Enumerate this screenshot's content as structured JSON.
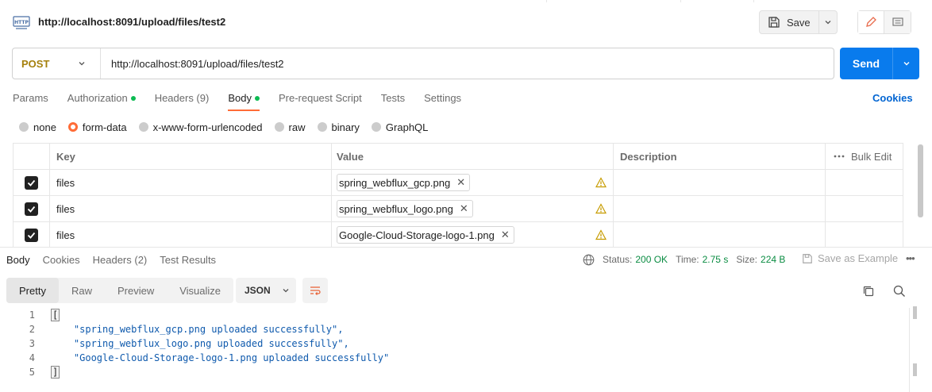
{
  "header": {
    "title": "http://localhost:8091/upload/files/test2",
    "save_label": "Save"
  },
  "request": {
    "method": "POST",
    "url": "http://localhost:8091/upload/files/test2",
    "send_label": "Send"
  },
  "request_tabs": [
    {
      "label": "Params",
      "dot": false
    },
    {
      "label": "Authorization",
      "dot": true
    },
    {
      "label": "Headers (9)",
      "dot": false
    },
    {
      "label": "Body",
      "dot": true,
      "active": true
    },
    {
      "label": "Pre-request Script",
      "dot": false
    },
    {
      "label": "Tests",
      "dot": false
    },
    {
      "label": "Settings",
      "dot": false
    }
  ],
  "cookies_label": "Cookies",
  "body_types": [
    {
      "label": "none",
      "selected": false
    },
    {
      "label": "form-data",
      "selected": true
    },
    {
      "label": "x-www-form-urlencoded",
      "selected": false
    },
    {
      "label": "raw",
      "selected": false
    },
    {
      "label": "binary",
      "selected": false
    },
    {
      "label": "GraphQL",
      "selected": false
    }
  ],
  "form_table": {
    "headers": {
      "key": "Key",
      "value": "Value",
      "description": "Description",
      "bulk_edit": "Bulk Edit"
    },
    "rows": [
      {
        "checked": true,
        "key": "files",
        "file": "spring_webflux_gcp.png"
      },
      {
        "checked": true,
        "key": "files",
        "file": "spring_webflux_logo.png"
      },
      {
        "checked": true,
        "key": "files",
        "file": "Google-Cloud-Storage-logo-1.png"
      }
    ]
  },
  "response_tabs": [
    {
      "label": "Body",
      "active": true
    },
    {
      "label": "Cookies",
      "active": false
    },
    {
      "label": "Headers (2)",
      "active": false
    },
    {
      "label": "Test Results",
      "active": false
    }
  ],
  "status": {
    "status_label": "Status:",
    "status_value": "200 OK",
    "time_label": "Time:",
    "time_value": "2.75 s",
    "size_label": "Size:",
    "size_value": "224 B",
    "save_example": "Save as Example"
  },
  "view_modes": [
    {
      "label": "Pretty",
      "active": true
    },
    {
      "label": "Raw",
      "active": false
    },
    {
      "label": "Preview",
      "active": false
    },
    {
      "label": "Visualize",
      "active": false
    }
  ],
  "format_select": "JSON",
  "code_lines": [
    {
      "num": "1",
      "text": "["
    },
    {
      "num": "2",
      "text": "    \"spring_webflux_gcp.png uploaded successfully\","
    },
    {
      "num": "3",
      "text": "    \"spring_webflux_logo.png uploaded successfully\","
    },
    {
      "num": "4",
      "text": "    \"Google-Cloud-Storage-logo-1.png uploaded successfully\""
    },
    {
      "num": "5",
      "text": "]"
    }
  ],
  "colors": {
    "accent": "#ff6c37",
    "send": "#097bed",
    "method": "#a5800c",
    "ok": "#0a8c42",
    "link": "#0265d2"
  }
}
